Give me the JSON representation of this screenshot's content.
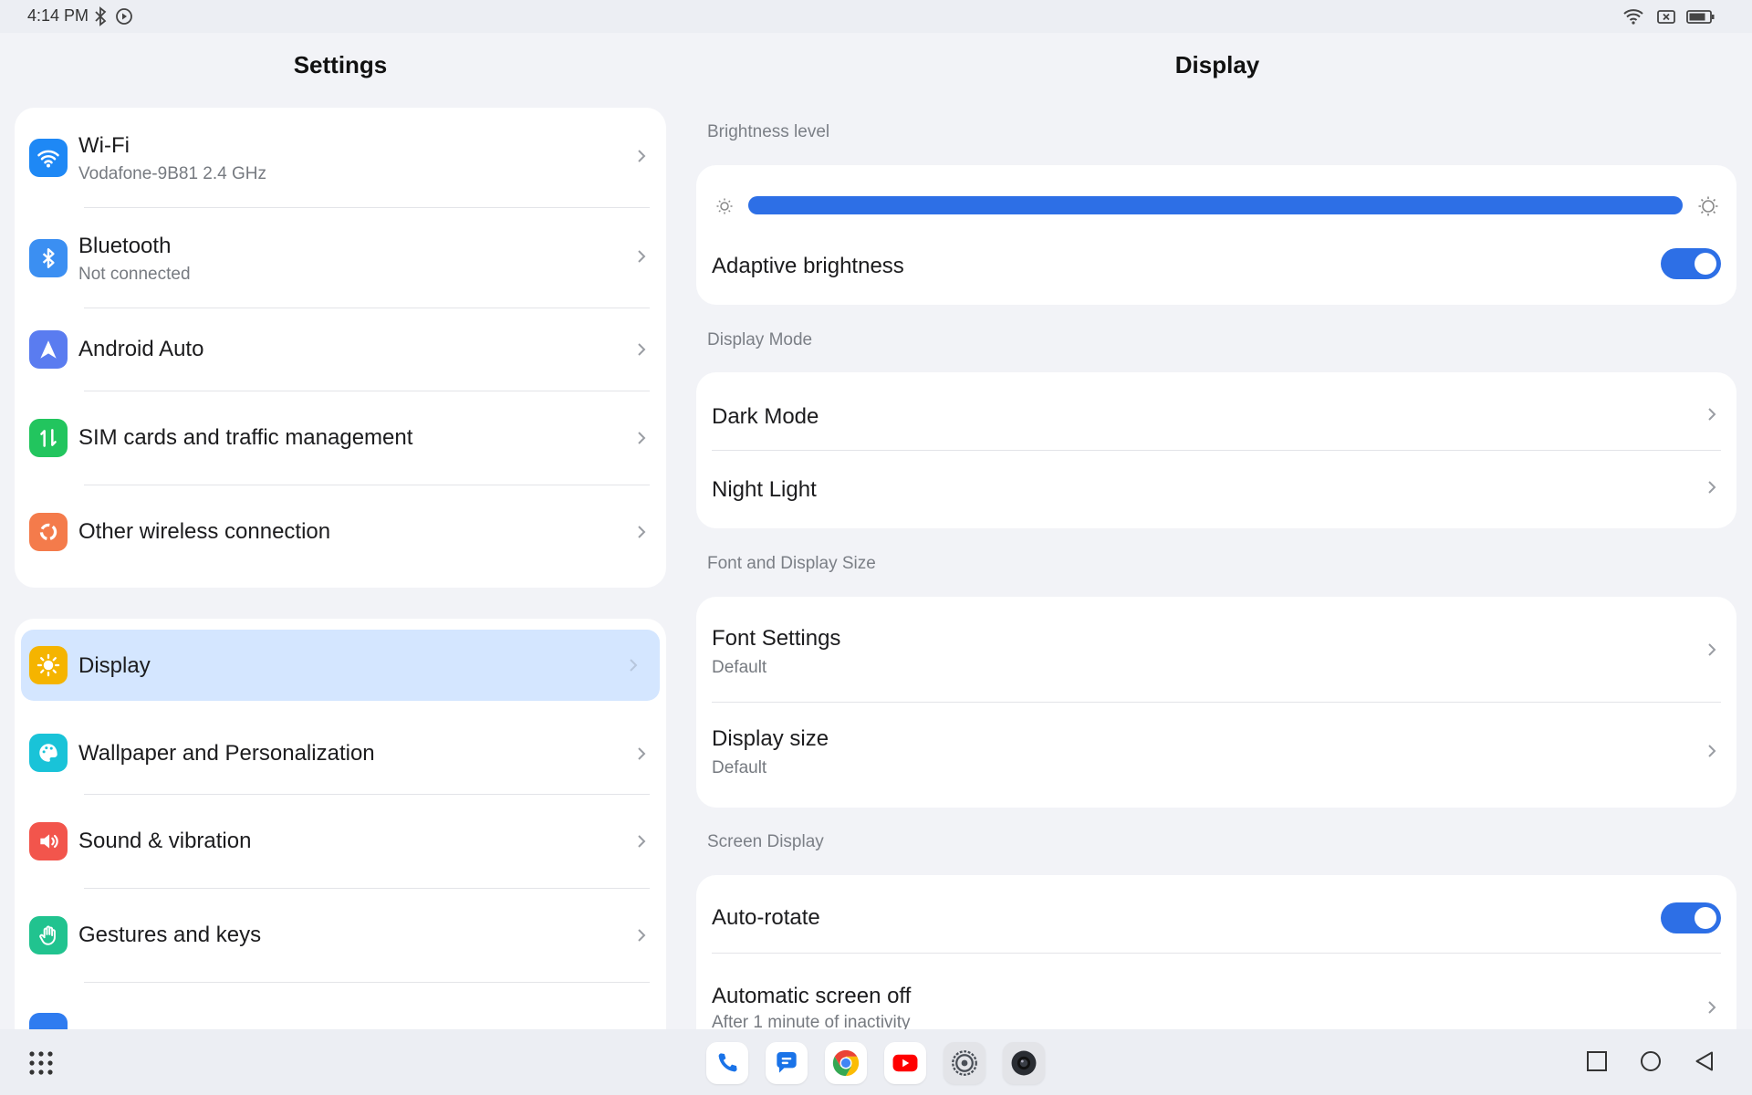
{
  "status_bar": {
    "time": "4:14 PM"
  },
  "left_pane": {
    "title": "Settings",
    "group1": [
      {
        "label": "Wi-Fi",
        "sub": "Vodafone-9B81 2.4 GHz",
        "icon": "wifi-icon",
        "color": "#1e88f5"
      },
      {
        "label": "Bluetooth",
        "sub": "Not connected",
        "icon": "bluetooth-icon",
        "color": "#3b8ff2"
      },
      {
        "label": "Android Auto",
        "icon": "android-auto-icon",
        "color": "#5a7cf0"
      },
      {
        "label": "SIM cards and traffic management",
        "icon": "sim-traffic-icon",
        "color": "#22c55e"
      },
      {
        "label": "Other wireless connection",
        "icon": "wireless-connection-icon",
        "color": "#f47b4b"
      }
    ],
    "group2": [
      {
        "label": "Display",
        "icon": "display-sun-icon",
        "color": "#f5b400",
        "selected": true
      },
      {
        "label": "Wallpaper and Personalization",
        "icon": "palette-icon",
        "color": "#19c3d8"
      },
      {
        "label": "Sound & vibration",
        "icon": "speaker-icon",
        "color": "#f2554c"
      },
      {
        "label": "Gestures and keys",
        "icon": "hand-icon",
        "color": "#21c38f"
      }
    ],
    "accent": "#d4e6ff"
  },
  "right_pane": {
    "title": "Display",
    "brightness": {
      "section": "Brightness level",
      "level": 1.0,
      "adaptive_label": "Adaptive brightness",
      "adaptive_on": true
    },
    "display_mode": {
      "section": "Display Mode",
      "dark_mode": "Dark Mode",
      "night_light": "Night Light"
    },
    "font_size": {
      "section": "Font and Display Size",
      "font_settings": "Font Settings",
      "font_settings_value": "Default",
      "display_size": "Display size",
      "display_size_value": "Default"
    },
    "screen_display": {
      "section": "Screen Display",
      "auto_rotate": "Auto-rotate",
      "auto_rotate_on": true,
      "screen_off": "Automatic screen off",
      "screen_off_value": "After 1 minute of inactivity"
    }
  },
  "dock": [
    "phone-icon",
    "messages-icon",
    "chrome-icon",
    "youtube-icon",
    "settings-app-icon",
    "camera-icon"
  ],
  "colors": {
    "accent_blue": "#2d6fe6",
    "background": "#f2f3f7"
  }
}
